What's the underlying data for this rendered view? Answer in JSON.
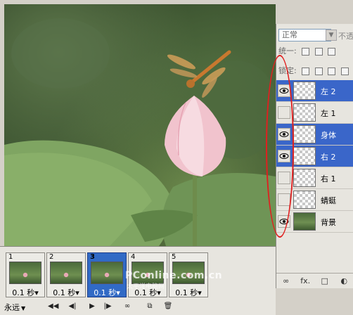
{
  "layers_panel": {
    "blend_mode": "正常",
    "opacity_label": "不透明",
    "unify_label": "统一:",
    "lock_label": "锁定:",
    "layers": [
      {
        "name": "左 2",
        "visible": true,
        "selected": true
      },
      {
        "name": "左 1",
        "visible": false,
        "selected": false
      },
      {
        "name": "身体",
        "visible": true,
        "selected": true
      },
      {
        "name": "右 2",
        "visible": true,
        "selected": true
      },
      {
        "name": "右 1",
        "visible": false,
        "selected": false
      },
      {
        "name": "蜻蜓",
        "visible": false,
        "selected": false
      },
      {
        "name": "背景",
        "visible": true,
        "selected": false
      }
    ],
    "footer": {
      "link": "∞",
      "fx": "fx.",
      "mask": "□",
      "adjust": "◐"
    }
  },
  "timeline": {
    "frames": [
      {
        "number": "1",
        "delay": "0.1 秒▾",
        "selected": false
      },
      {
        "number": "2",
        "delay": "0.1 秒▾",
        "selected": false
      },
      {
        "number": "3",
        "delay": "0.1 秒▾",
        "selected": true
      },
      {
        "number": "4",
        "delay": "0.1 秒▾",
        "selected": false
      },
      {
        "number": "5",
        "delay": "0.1 秒▾",
        "selected": false
      }
    ],
    "loop": "永远",
    "buttons": {
      "first": "◀◀",
      "prev": "◀|",
      "play": "▶",
      "next": "|▶",
      "tween": "∞",
      "new": "⧉",
      "delete": "🗑"
    }
  },
  "watermark": {
    "line1": "PConline.com.cn",
    "line2": "太平洋电脑网"
  },
  "colors": {
    "selection": "#3a66c9",
    "annotation": "#e02020",
    "panel": "#e7e5df"
  }
}
